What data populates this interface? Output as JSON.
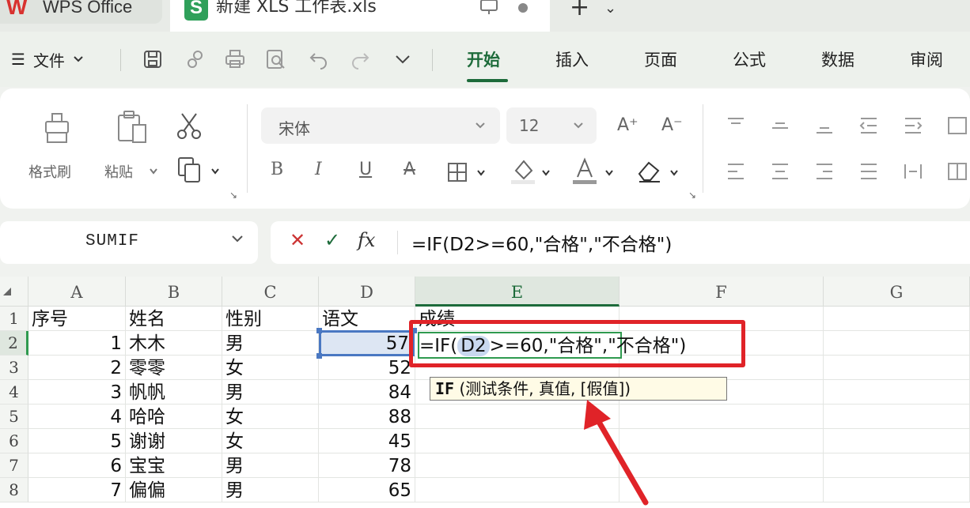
{
  "titlebar": {
    "app_name": "WPS Office",
    "app_logo": "W",
    "doc_icon": "S",
    "doc_title": "新建 XLS 工作表.xls",
    "new_tab": "+",
    "tab_list": "⌄"
  },
  "menubar": {
    "file_menu_icon": "☰",
    "file_label": "文件",
    "tabs": [
      {
        "label": "开始",
        "active": true
      },
      {
        "label": "插入"
      },
      {
        "label": "页面"
      },
      {
        "label": "公式"
      },
      {
        "label": "数据"
      },
      {
        "label": "审阅"
      }
    ]
  },
  "ribbon": {
    "format_painter_label": "格式刷",
    "paste_label": "粘贴",
    "font_name": "宋体",
    "font_size": "12",
    "font_grow": "A⁺",
    "font_shrink": "A⁻",
    "bold": "B",
    "italic": "I",
    "underline": "U",
    "strike": "A"
  },
  "formula_bar": {
    "name_box": "SUMIF",
    "cancel": "✕",
    "confirm": "✓",
    "fx": "fx",
    "formula": "=IF(D2>=60,\"合格\",\"不合格\")"
  },
  "sheet": {
    "columns": [
      "A",
      "B",
      "C",
      "D",
      "E",
      "F",
      "G"
    ],
    "selected_column": "E",
    "rows": [
      {
        "n": "1",
        "a": "序号",
        "b": "姓名",
        "c": "性别",
        "d": "语文",
        "e": "成绩"
      },
      {
        "n": "2",
        "a": "1",
        "b": "木木",
        "c": "男",
        "d": "57"
      },
      {
        "n": "3",
        "a": "2",
        "b": "零零",
        "c": "女",
        "d": "52"
      },
      {
        "n": "4",
        "a": "3",
        "b": "帆帆",
        "c": "男",
        "d": "84"
      },
      {
        "n": "5",
        "a": "4",
        "b": "哈哈",
        "c": "女",
        "d": "88"
      },
      {
        "n": "6",
        "a": "5",
        "b": "谢谢",
        "c": "女",
        "d": "45"
      },
      {
        "n": "7",
        "a": "6",
        "b": "宝宝",
        "c": "男",
        "d": "78"
      },
      {
        "n": "8",
        "a": "7",
        "b": "偏偏",
        "c": "男",
        "d": "65"
      }
    ],
    "edit_cell": {
      "prefix": "=IF(",
      "ref": "D2",
      "suffix": ">=60,\"合格\",\"不合格\")"
    },
    "tooltip": {
      "func": "IF",
      "args": " (测试条件, 真值, [假值])"
    }
  },
  "colors": {
    "accent": "#1d6b3a",
    "annotation_red": "#e02328",
    "ref_blue": "#4a78c2"
  }
}
